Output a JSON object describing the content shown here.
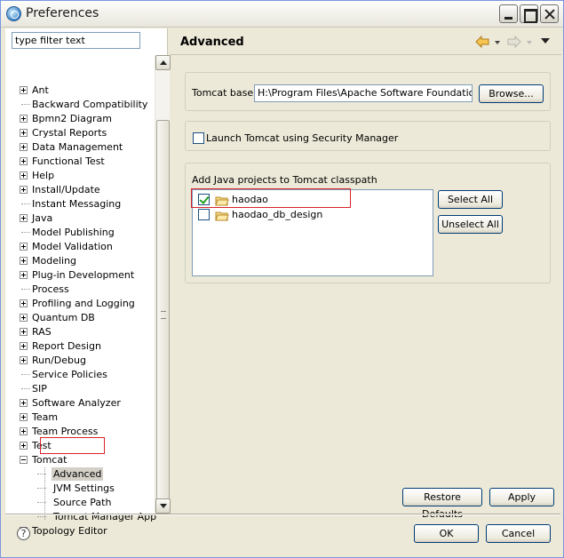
{
  "window": {
    "title": "Preferences"
  },
  "filter": {
    "placeholder": "type filter text"
  },
  "tree": {
    "items": [
      {
        "label": "Ant",
        "expandable": true
      },
      {
        "label": "Backward Compatibility",
        "expandable": false
      },
      {
        "label": "Bpmn2 Diagram",
        "expandable": true
      },
      {
        "label": "Crystal Reports",
        "expandable": true
      },
      {
        "label": "Data Management",
        "expandable": true
      },
      {
        "label": "Functional Test",
        "expandable": true
      },
      {
        "label": "Help",
        "expandable": true
      },
      {
        "label": "Install/Update",
        "expandable": true
      },
      {
        "label": "Instant Messaging",
        "expandable": false
      },
      {
        "label": "Java",
        "expandable": true
      },
      {
        "label": "Model Publishing",
        "expandable": false
      },
      {
        "label": "Model Validation",
        "expandable": true
      },
      {
        "label": "Modeling",
        "expandable": true
      },
      {
        "label": "Plug-in Development",
        "expandable": true
      },
      {
        "label": "Process",
        "expandable": false
      },
      {
        "label": "Profiling and Logging",
        "expandable": true
      },
      {
        "label": "Quantum DB",
        "expandable": true
      },
      {
        "label": "RAS",
        "expandable": true
      },
      {
        "label": "Report Design",
        "expandable": true
      },
      {
        "label": "Run/Debug",
        "expandable": true
      },
      {
        "label": "Service Policies",
        "expandable": false
      },
      {
        "label": "SIP",
        "expandable": false
      },
      {
        "label": "Software Analyzer",
        "expandable": true
      },
      {
        "label": "Team",
        "expandable": true
      },
      {
        "label": "Team Process",
        "expandable": true
      },
      {
        "label": "Test",
        "expandable": true
      },
      {
        "label": "Tomcat",
        "expandable": true,
        "expanded": true
      },
      {
        "label": "Advanced",
        "child": true,
        "selected": true
      },
      {
        "label": "JVM Settings",
        "child": true
      },
      {
        "label": "Source Path",
        "child": true
      },
      {
        "label": "Tomcat Manager App",
        "child": true
      },
      {
        "label": "Topology Editor",
        "expandable": true
      }
    ]
  },
  "page": {
    "title": "Advanced",
    "tomcat_base_label": "Tomcat base",
    "tomcat_base_value": "H:\\Program Files\\Apache Software Foundation\\Tomcat",
    "browse_label": "Browse...",
    "security_manager_label": "Launch Tomcat using Security Manager",
    "security_manager_checked": false,
    "classpath_label": "Add Java projects to Tomcat classpath",
    "projects": [
      {
        "name": "haodao",
        "checked": true
      },
      {
        "name": "haodao_db_design",
        "checked": false
      }
    ],
    "select_all_label": "Select All",
    "unselect_all_label": "Unselect All",
    "restore_defaults_label": "Restore Defaults",
    "apply_label": "Apply"
  },
  "footer": {
    "help_glyph": "?",
    "ok_label": "OK",
    "cancel_label": "Cancel"
  },
  "colors": {
    "highlight_box": "#d8232a",
    "window_bg": "#ece9d8",
    "check_mark": "#21a121"
  }
}
